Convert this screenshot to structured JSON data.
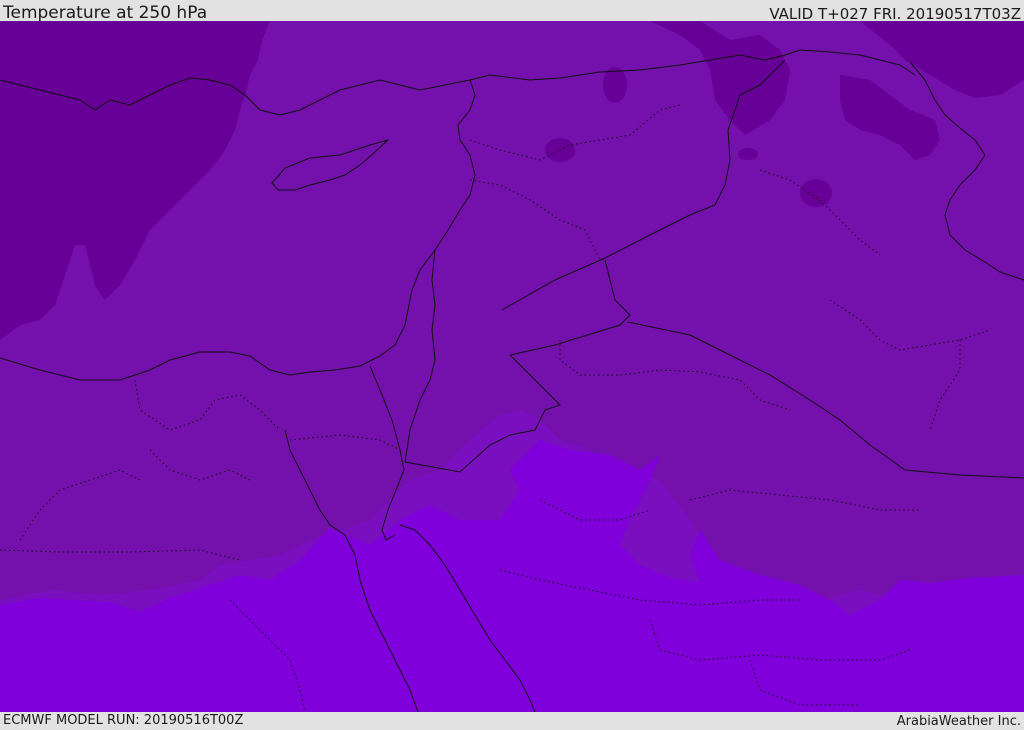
{
  "header": {
    "title": "Temperature at 250 hPa",
    "valid": "VALID T+027 FRI. 20190517T03Z"
  },
  "footer": {
    "model_run": "ECMWF MODEL RUN: 20190516T00Z",
    "credit": "ArabiaWeather Inc."
  },
  "map": {
    "colors": {
      "coldest": "#660096",
      "cold": "#7410ac",
      "mid": "#7a0fc0",
      "warm": "#7f00db",
      "border": "#111111"
    }
  }
}
